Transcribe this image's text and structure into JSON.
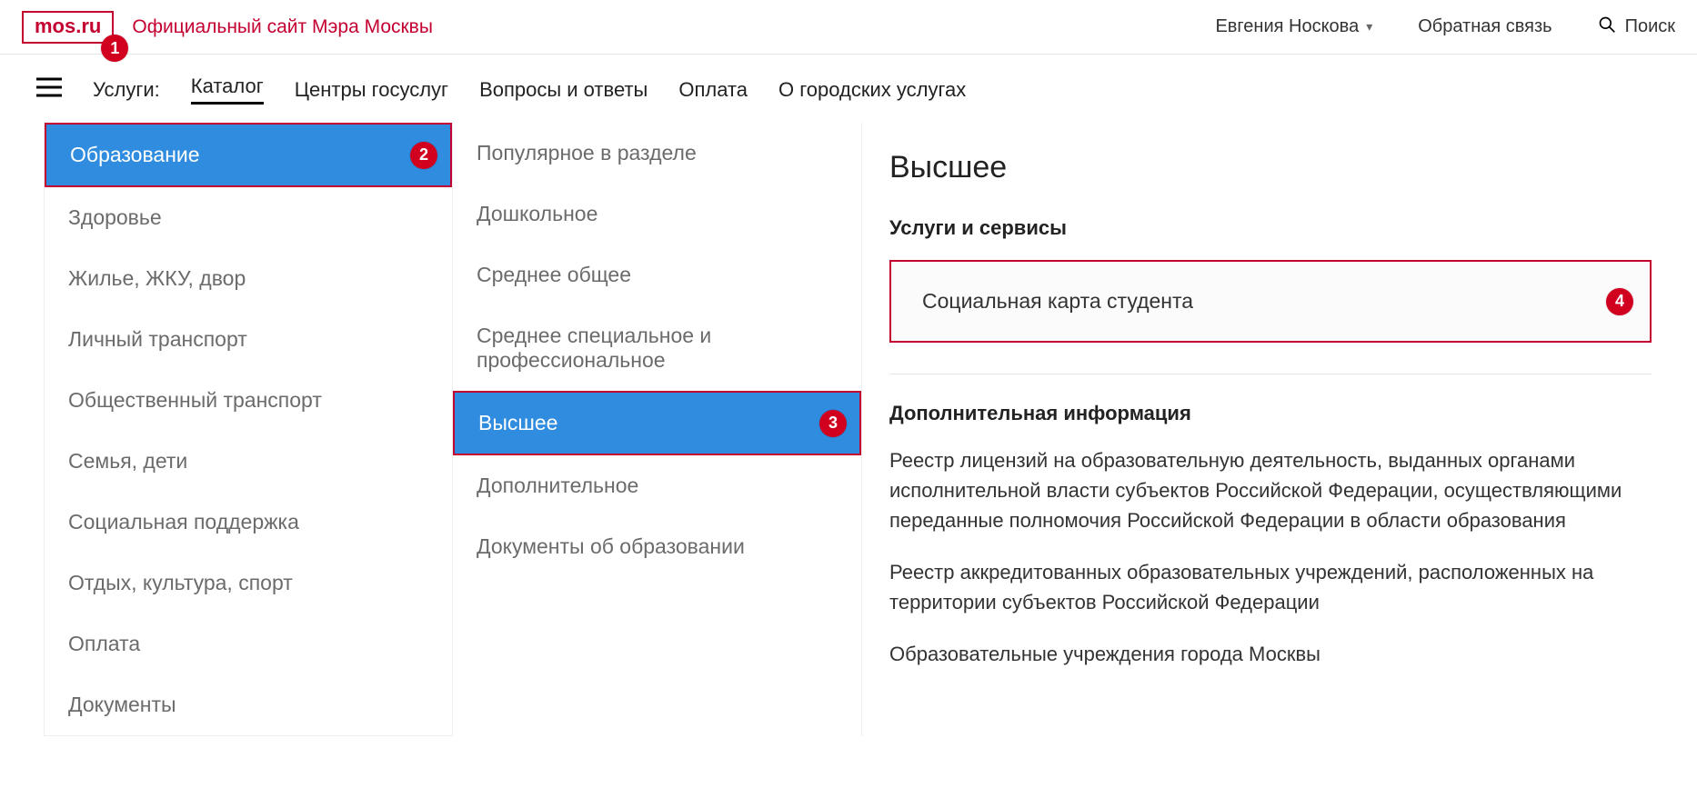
{
  "header": {
    "logo_text": "mos.ru",
    "site_subtitle": "Официальный сайт Мэра Москвы",
    "username": "Евгения Носкова",
    "feedback_label": "Обратная связь",
    "search_label": "Поиск"
  },
  "nav": {
    "label": "Услуги:",
    "items": [
      {
        "label": "Каталог",
        "active": true
      },
      {
        "label": "Центры госуслуг",
        "active": false
      },
      {
        "label": "Вопросы и ответы",
        "active": false
      },
      {
        "label": "Оплата",
        "active": false
      },
      {
        "label": "О городских услугах",
        "active": false
      }
    ]
  },
  "categories_primary": [
    {
      "label": "Образование",
      "selected": true,
      "badge": "2"
    },
    {
      "label": "Здоровье"
    },
    {
      "label": "Жилье, ЖКУ, двор"
    },
    {
      "label": "Личный транспорт"
    },
    {
      "label": "Общественный транспорт"
    },
    {
      "label": "Семья, дети"
    },
    {
      "label": "Социальная поддержка"
    },
    {
      "label": "Отдых, культура, спорт"
    },
    {
      "label": "Оплата"
    },
    {
      "label": "Документы"
    }
  ],
  "categories_secondary": [
    {
      "label": "Популярное в разделе"
    },
    {
      "label": "Дошкольное"
    },
    {
      "label": "Среднее общее"
    },
    {
      "label": "Среднее специальное и профессиональное"
    },
    {
      "label": "Высшее",
      "selected": true,
      "badge": "3"
    },
    {
      "label": "Дополнительное"
    },
    {
      "label": "Документы об образовании"
    }
  ],
  "content": {
    "title": "Высшее",
    "services_heading": "Услуги и сервисы",
    "service_card": {
      "label": "Социальная карта студента",
      "badge": "4"
    },
    "info_heading": "Дополнительная информация",
    "info_items": [
      "Реестр лицензий на образовательную деятельность, выданных органами исполнительной власти субъектов Российской Федерации, осуществляющими переданные полномочия Российской Федерации в области образования",
      "Реестр аккредитованных образовательных учреждений, расположенных на территории субъектов Российской Федерации",
      "Образовательные учреждения города Москвы"
    ]
  },
  "badges": {
    "logo": "1"
  }
}
